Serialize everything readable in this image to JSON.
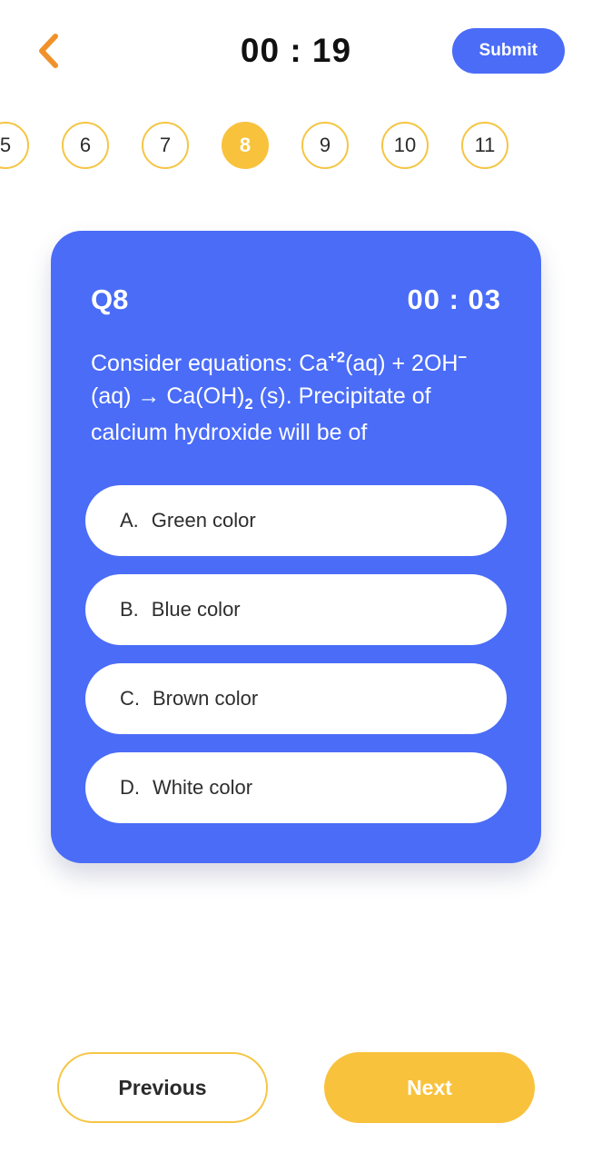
{
  "header": {
    "back_icon": "chevron-left-icon",
    "timer": "00 : 19",
    "submit_label": "Submit"
  },
  "question_nav": {
    "items": [
      {
        "label": "5",
        "active": false
      },
      {
        "label": "6",
        "active": false
      },
      {
        "label": "7",
        "active": false
      },
      {
        "label": "8",
        "active": true
      },
      {
        "label": "9",
        "active": false
      },
      {
        "label": "10",
        "active": false
      },
      {
        "label": "11",
        "active": false
      }
    ]
  },
  "card": {
    "question_number": "Q8",
    "timer": "00 : 03",
    "question_parts": {
      "p1": "Consider equations: Ca",
      "sup1": "+2",
      "p2": "(aq) + 2OH",
      "sup2": "−",
      "p3": "(aq) → Ca(OH)",
      "sub1": "2",
      "p4": " (s). Precipitate of calcium hydroxide will be of"
    },
    "options": [
      {
        "letter": "A.",
        "label": "Green color"
      },
      {
        "letter": "B.",
        "label": "Blue color"
      },
      {
        "letter": "C.",
        "label": "Brown color"
      },
      {
        "letter": "D.",
        "label": "White color"
      }
    ]
  },
  "footer": {
    "previous_label": "Previous",
    "next_label": "Next"
  },
  "colors": {
    "card_blue": "#4a6cf7",
    "accent_gold": "#f9c23c",
    "nav_border_gold": "#f5c544",
    "back_orange": "#f0922b",
    "text_dark": "#2e2e2e",
    "background": "#ffffff"
  }
}
